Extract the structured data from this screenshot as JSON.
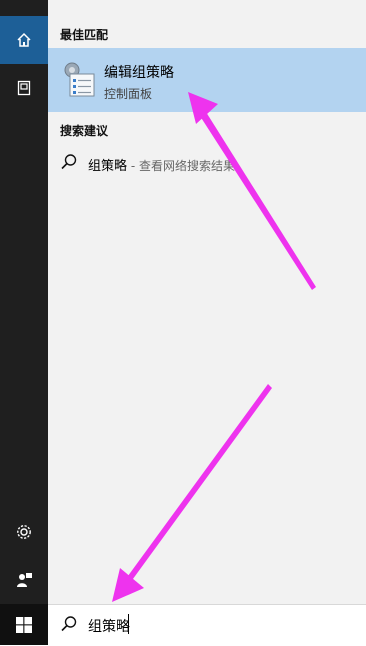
{
  "sidebar": {
    "items": [
      {
        "icon": "home-icon"
      },
      {
        "icon": "notebook-icon"
      },
      {
        "icon": "gear-icon"
      },
      {
        "icon": "feedback-icon"
      },
      {
        "icon": "windows-start-icon"
      }
    ]
  },
  "sections": {
    "best_match_title": "最佳匹配",
    "suggestions_title": "搜索建议"
  },
  "best_match": {
    "title": "编辑组策略",
    "subtitle": "控制面板",
    "icon": "group-policy-icon"
  },
  "suggestion": {
    "query": "组策略",
    "hint": " - 查看网络搜索结果"
  },
  "search": {
    "value": "组策略"
  },
  "colors": {
    "rail": "#1f1f1f",
    "home_active": "#1d5f97",
    "highlight": "#b3d3f0",
    "panel": "#f2f2f2",
    "annotation_arrow": "#ee33ee"
  }
}
